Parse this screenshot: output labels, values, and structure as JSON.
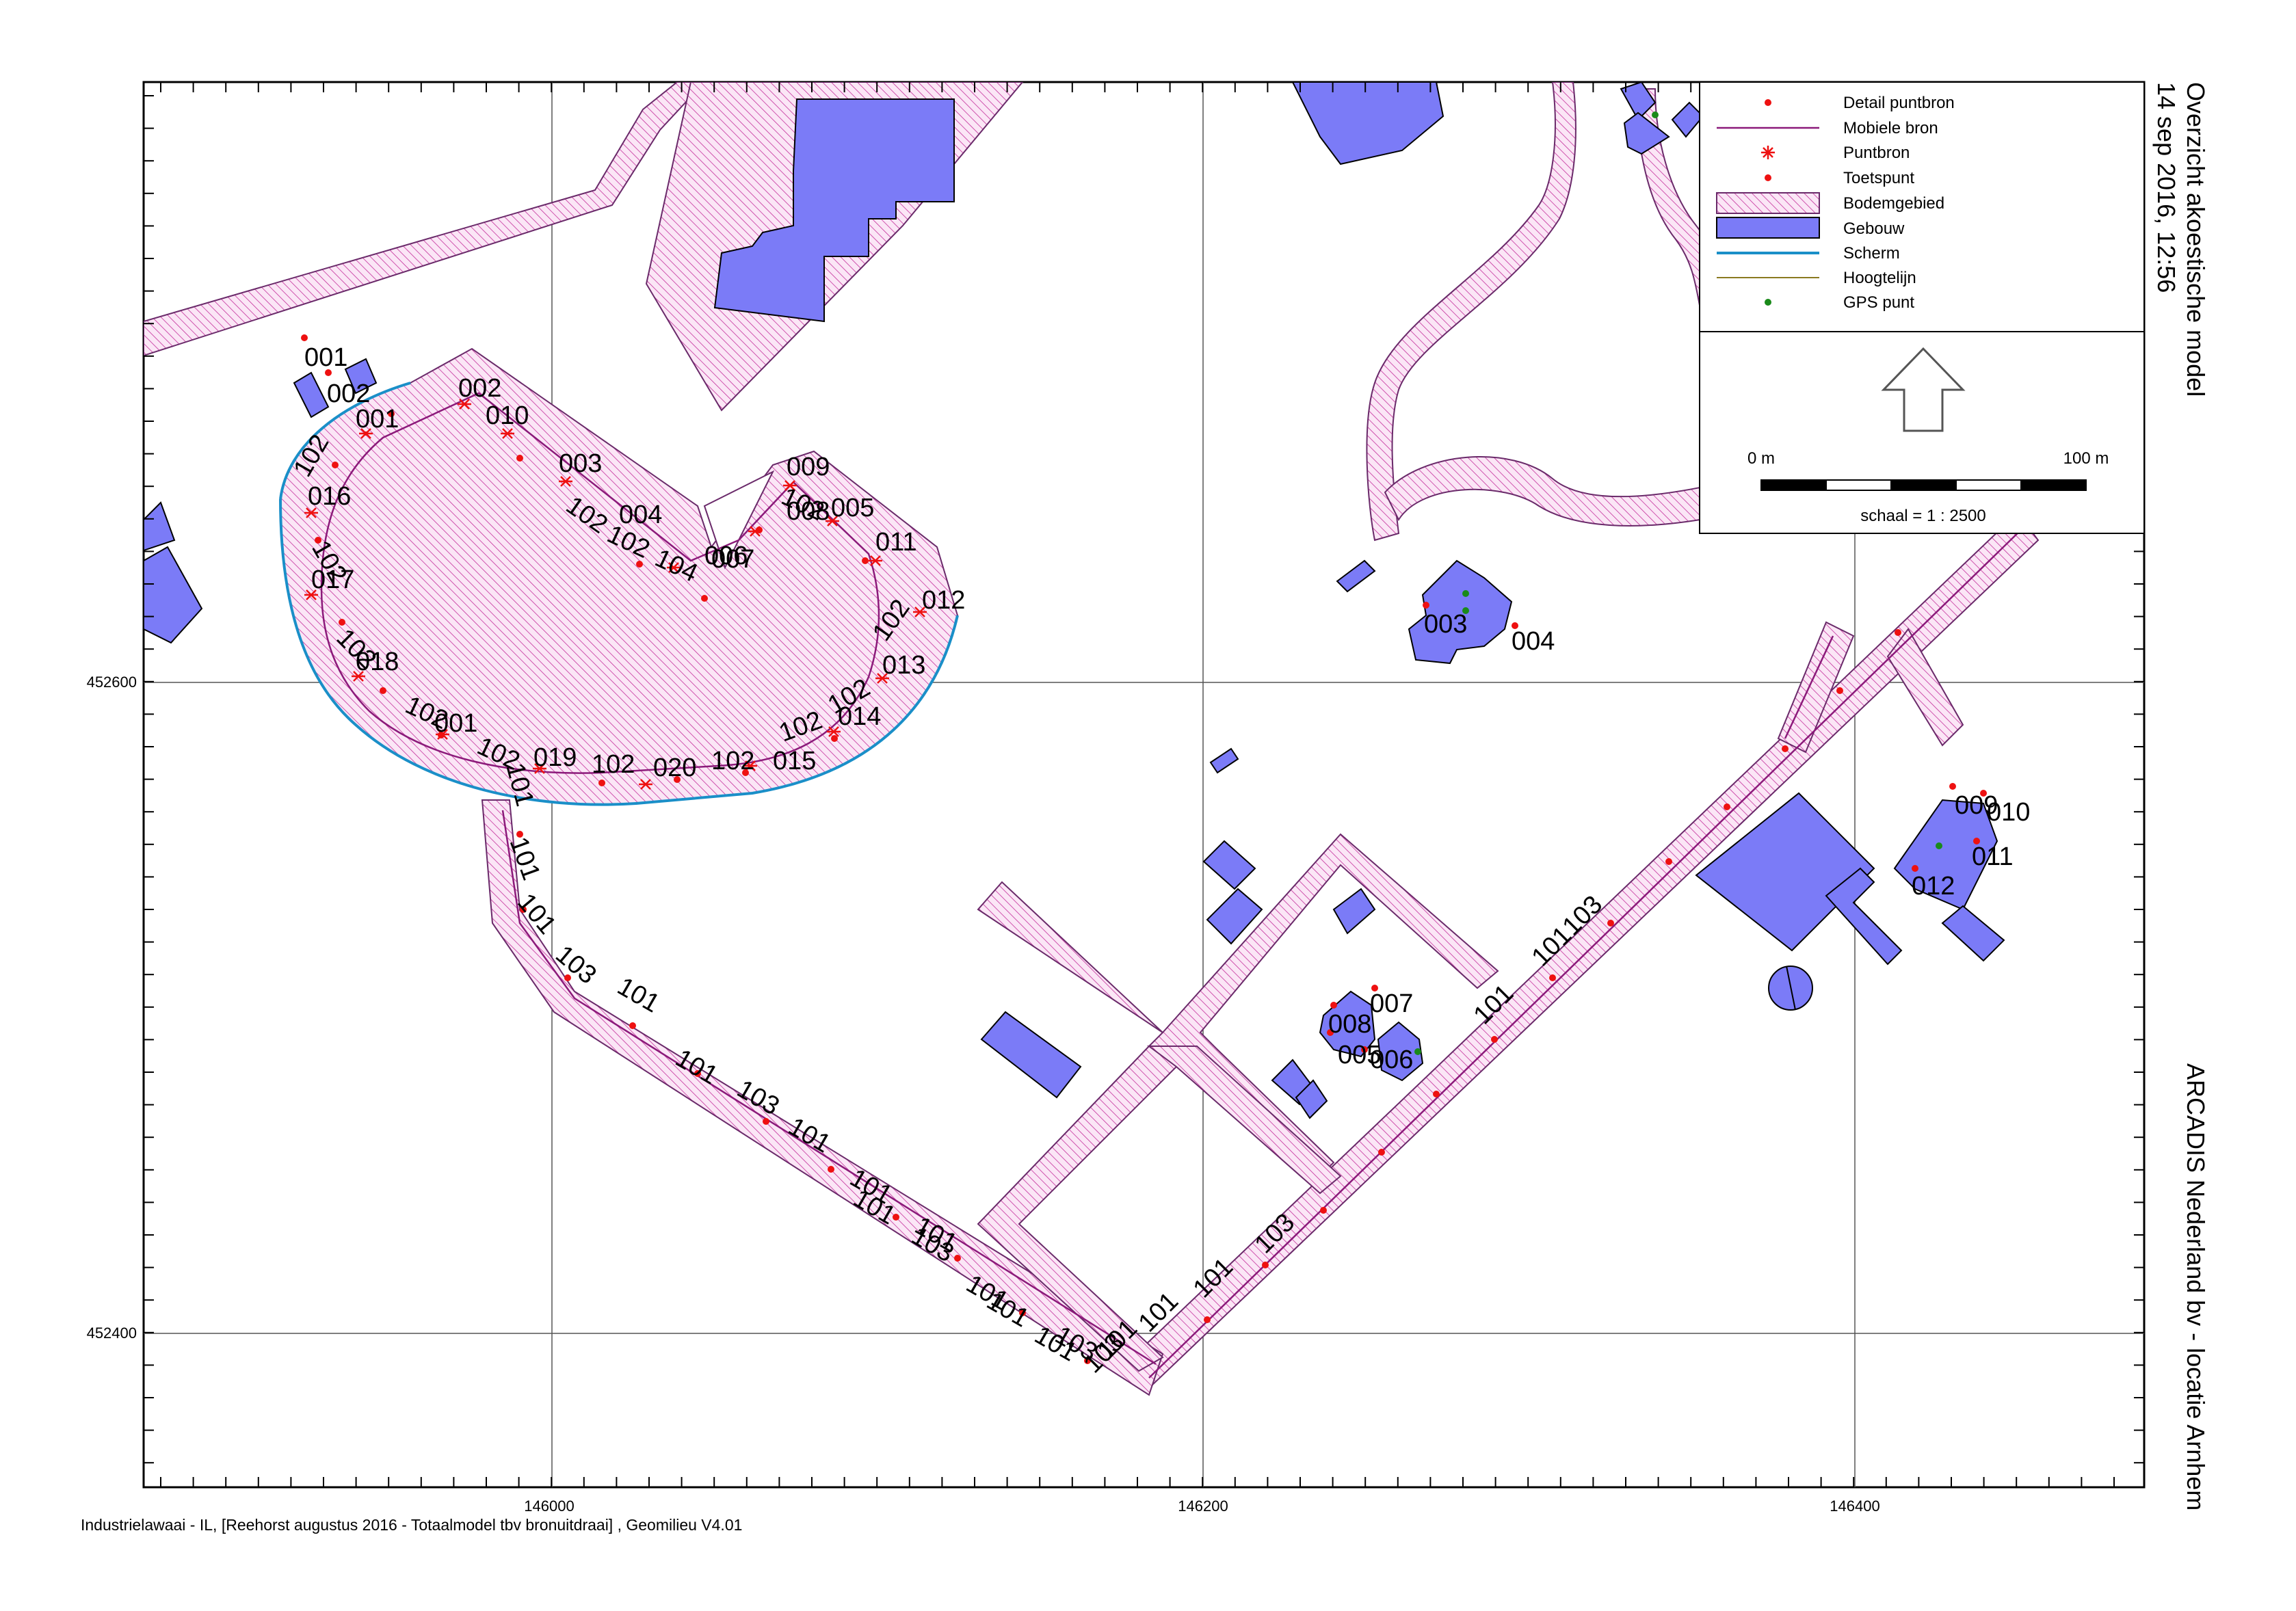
{
  "title": "Overzicht akoestische model",
  "timestamp": "14 sep 2016, 12:56",
  "company": "ARCADIS Nederland bv - locatie Arnhem",
  "footer": "Industrielawaai - IL, [Reehorst augustus 2016 - Totaalmodel tbv bronuitdraai] , Geomilieu V4.01",
  "axes": {
    "x_ticks": [
      "146000",
      "146200",
      "146400"
    ],
    "y_ticks": [
      "452600",
      "452400"
    ]
  },
  "legend": {
    "items": [
      {
        "label": "Detail puntbron",
        "symbol": "dot-red"
      },
      {
        "label": "Mobiele bron",
        "symbol": "line-purple"
      },
      {
        "label": "Puntbron",
        "symbol": "asterisk-red"
      },
      {
        "label": "Toetspunt",
        "symbol": "dot-red"
      },
      {
        "label": "Bodemgebied",
        "symbol": "hatch-pink"
      },
      {
        "label": "Gebouw",
        "symbol": "fill-blue"
      },
      {
        "label": "Scherm",
        "symbol": "line-blue"
      },
      {
        "label": "Hoogtelijn",
        "symbol": "line-olive"
      },
      {
        "label": "GPS punt",
        "symbol": "dot-green"
      }
    ],
    "north_arrow": "north-arrow-icon",
    "scale_start": "0 m",
    "scale_end": "100 m",
    "scale_text": "schaal = 1 : 2500"
  },
  "colors": {
    "building": "#7b7bf7",
    "hatch": "#c4309c",
    "hatch_bg": "#fbe6f6",
    "mobile": "#8b1a7a",
    "screen": "#1a8fc8",
    "point": "#ee1111",
    "gps": "#1a8a1a"
  },
  "labels": {
    "toetspunten_right": [
      "003",
      "004",
      "007",
      "008",
      "005",
      "006",
      "009",
      "010",
      "011",
      "012"
    ],
    "toetspunten_left": [
      "001",
      "002",
      "001"
    ],
    "ring": [
      "002",
      "010",
      "003",
      "102",
      "004",
      "102",
      "104",
      "006",
      "007",
      "009",
      "102",
      "005",
      "008",
      "011",
      "012",
      "102",
      "013",
      "102",
      "014",
      "102",
      "015",
      "102",
      "020",
      "102",
      "019",
      "102",
      "001",
      "102",
      "018",
      "102",
      "017",
      "102",
      "016",
      "102"
    ],
    "road": [
      "101",
      "101",
      "101",
      "103",
      "101",
      "101",
      "103",
      "101",
      "101",
      "103",
      "101",
      "101",
      "103",
      "101",
      "101",
      "103",
      "101",
      "101",
      "103",
      "101",
      "101",
      "101",
      "103",
      "101"
    ]
  }
}
